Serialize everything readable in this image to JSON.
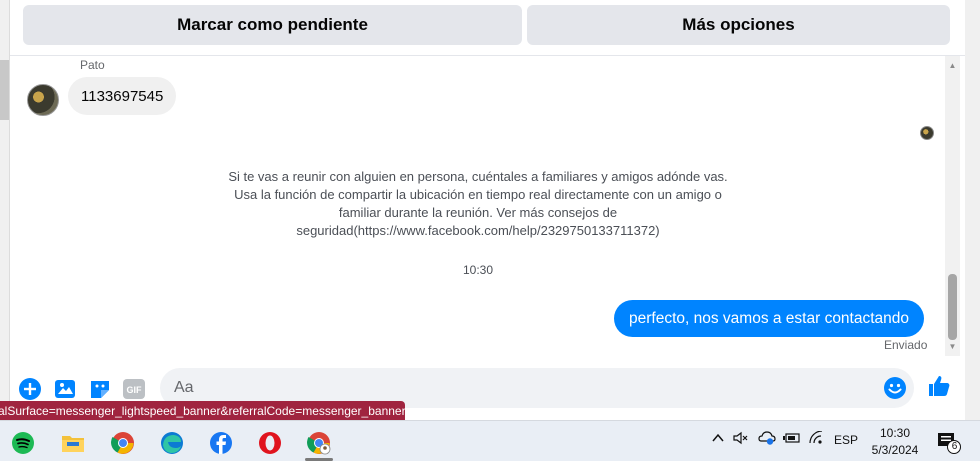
{
  "header": {
    "mark_pending_label": "Marcar como pendiente",
    "more_options_label": "Más opciones"
  },
  "conversation": {
    "sender_name": "Pato",
    "incoming_message": "1133697545",
    "safety_notice": "Si te vas a reunir con alguien en persona, cuéntales a familiares y amigos adónde vas. Usa la función de compartir la ubicación en tiempo real directamente con un amigo o familiar durante la reunión. Ver más consejos de seguridad(https://www.facebook.com/help/2329750133711372)",
    "timestamp": "10:30",
    "outgoing_message": "perfecto, nos vamos a estar contactando",
    "delivery_status": "Enviado"
  },
  "composer": {
    "placeholder": "Aa",
    "gif_label": "GIF"
  },
  "status_url": "alSurface=messenger_lightspeed_banner&referralCode=messenger_banner",
  "taskbar": {
    "apps": [
      "spotify-icon",
      "file-explorer-icon",
      "chrome-icon",
      "edge-icon",
      "facebook-icon",
      "opera-icon",
      "chrome-profile-icon"
    ],
    "language": "ESP",
    "time": "10:30",
    "date": "5/3/2024",
    "notification_count": "6"
  },
  "colors": {
    "messenger_blue": "#0084ff",
    "status_bar": "#a0243f",
    "button_gray": "#e4e6eb"
  }
}
